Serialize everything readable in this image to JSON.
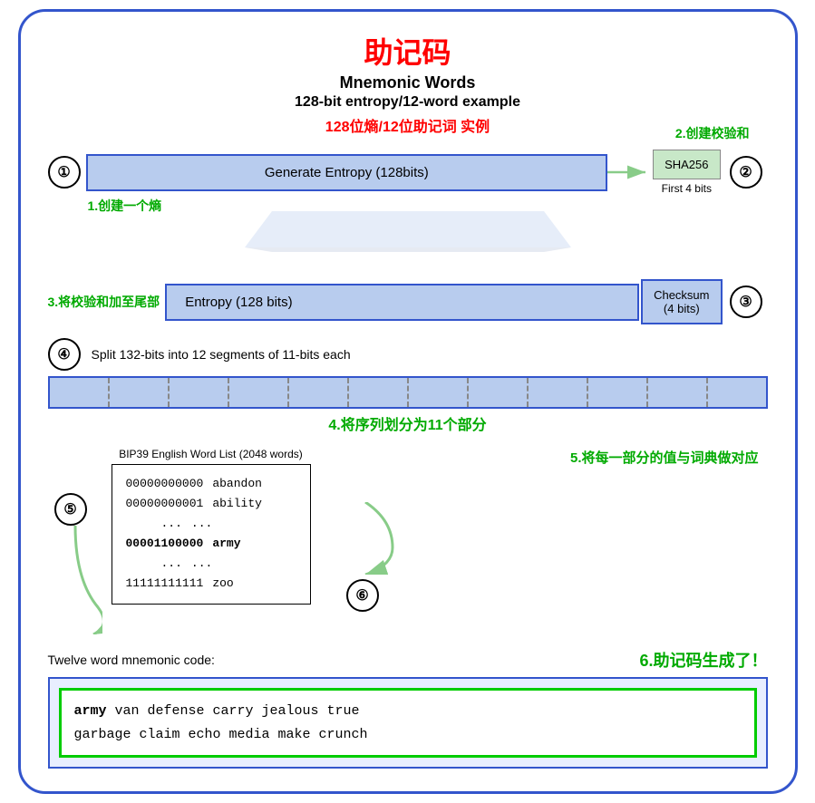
{
  "title": {
    "zh": "助记码",
    "en1": "Mnemonic Words",
    "en2": "128-bit entropy/12-word example",
    "zh2": "128位熵/12位助记词 实例"
  },
  "labels": {
    "label1": "1.创建一个熵",
    "label2": "2.创建校验和",
    "label3": "3.将校验和加至尾部",
    "label4": "4.将序列划分为11个部分",
    "label5": "5.将每一部分的值与词典做对应",
    "label6": "6.助记码生成了！"
  },
  "step1": {
    "circle": "①",
    "box": "Generate Entropy (128bits)",
    "sha": "SHA256",
    "first4bits": "First 4 bits",
    "circle2": "②"
  },
  "step3": {
    "entropy": "Entropy (128 bits)",
    "checksum": "Checksum",
    "checksum2": "(4 bits)",
    "circle3": "③"
  },
  "step4": {
    "circle": "④",
    "split_text": "Split 132-bits into 12 segments of 11-bits each"
  },
  "step5": {
    "circle": "⑤",
    "wordlist_title": "BIP39 English Word List (2048 words)",
    "rows": [
      {
        "num": "00000000000",
        "word": "abandon"
      },
      {
        "num": "00000000001",
        "word": "ability"
      },
      {
        "num": "...",
        "word": "..."
      },
      {
        "num": "00001100000",
        "word": "army",
        "bold": true
      },
      {
        "num": "...",
        "word": "..."
      },
      {
        "num": "11111111111",
        "word": "zoo"
      }
    ]
  },
  "step6": {
    "circle": "⑥",
    "label": "Twelve word mnemonic code:",
    "mnemonic": "army van defense carry jealous true garbage claim echo media make crunch",
    "mnemonic_bold": "army",
    "mnemonic_rest": " van defense carry jealous true\ngarbage claim echo media make crunch"
  }
}
